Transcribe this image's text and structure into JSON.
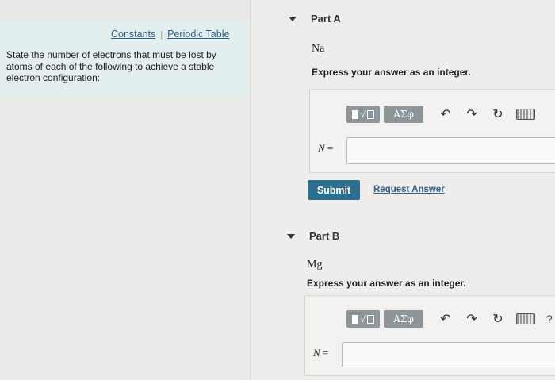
{
  "left": {
    "links": [
      {
        "label": "Constants"
      },
      {
        "label": "Periodic Table"
      }
    ],
    "separator": "|",
    "question": "State the number of electrons that must be lost by atoms of each of the following to achieve a stable electron configuration:"
  },
  "parts": [
    {
      "title": "Part A",
      "element": "Na",
      "instruction": "Express your answer as an integer.",
      "answer_label_var": "N",
      "answer_label_eq": " =",
      "answer_value": "",
      "submit_label": "Submit",
      "request_label": "Request Answer"
    },
    {
      "title": "Part B",
      "element": "Mg",
      "instruction": "Express your answer as an integer.",
      "answer_label_var": "N",
      "answer_label_eq": " =",
      "answer_value": ""
    }
  ],
  "toolbar": {
    "greek_label": "ΑΣφ",
    "undo_glyph": "↶",
    "redo_glyph": "↷",
    "reset_glyph": "↻",
    "help_glyph": "?",
    "icons": [
      "templates-icon",
      "greek-symbols-icon",
      "undo-icon",
      "redo-icon",
      "reset-icon",
      "keyboard-icon",
      "help-icon"
    ]
  },
  "colors": {
    "submit": "#2e6f8e",
    "link": "#2f5f8a",
    "left_panel": "#e2efee"
  }
}
